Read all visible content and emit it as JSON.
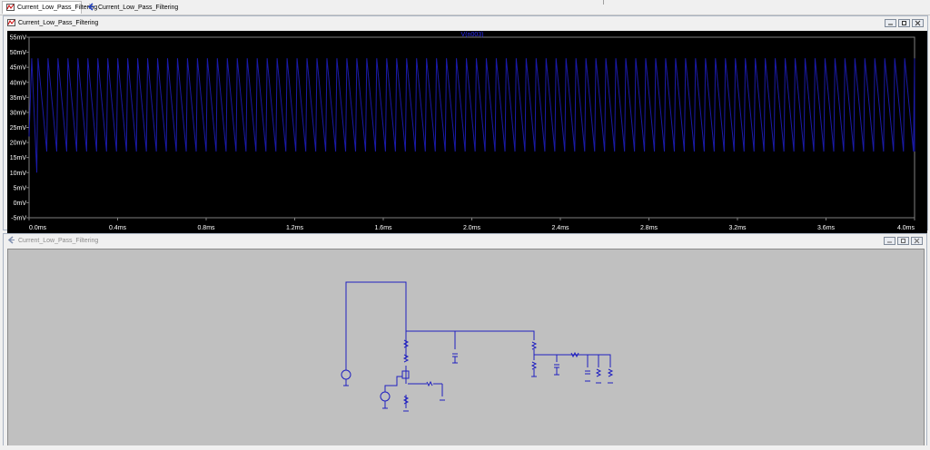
{
  "tabs": [
    {
      "label": "Current_Low_Pass_Filtering",
      "icon": "waveform-icon",
      "active": true
    },
    {
      "label": "Current_Low_Pass_Filtering",
      "icon": "schematic-icon",
      "active": false
    }
  ],
  "plot_window": {
    "title": "Current_Low_Pass_Filtering",
    "icon": "waveform-icon"
  },
  "schematic_window": {
    "title": "Current_Low_Pass_Filtering",
    "icon": "schematic-icon"
  },
  "colors": {
    "plot_bg": "#000000",
    "trace": "#1a1aa8",
    "axis_text": "#ffffff",
    "grid": "#404040",
    "trace_label": "#2b2bff",
    "wire": "#2020c0",
    "schematic_bg": "#c0c0c0"
  },
  "chart_data": {
    "type": "line",
    "series": [
      {
        "name": "V(n003)",
        "period_ms": 0.045,
        "min_mV": 17,
        "max_mV": 48
      }
    ],
    "x_ticks": [
      "0.0ms",
      "0.4ms",
      "0.8ms",
      "1.2ms",
      "1.6ms",
      "2.0ms",
      "2.4ms",
      "2.8ms",
      "3.2ms",
      "3.6ms",
      "4.0ms"
    ],
    "y_ticks": [
      "55mV",
      "50mV",
      "45mV",
      "40mV",
      "35mV",
      "30mV",
      "25mV",
      "20mV",
      "15mV",
      "10mV",
      "5mV",
      "0mV",
      "-5mV"
    ],
    "xlim": [
      0,
      4.0
    ],
    "ylim": [
      -5,
      55
    ],
    "grid": false
  }
}
